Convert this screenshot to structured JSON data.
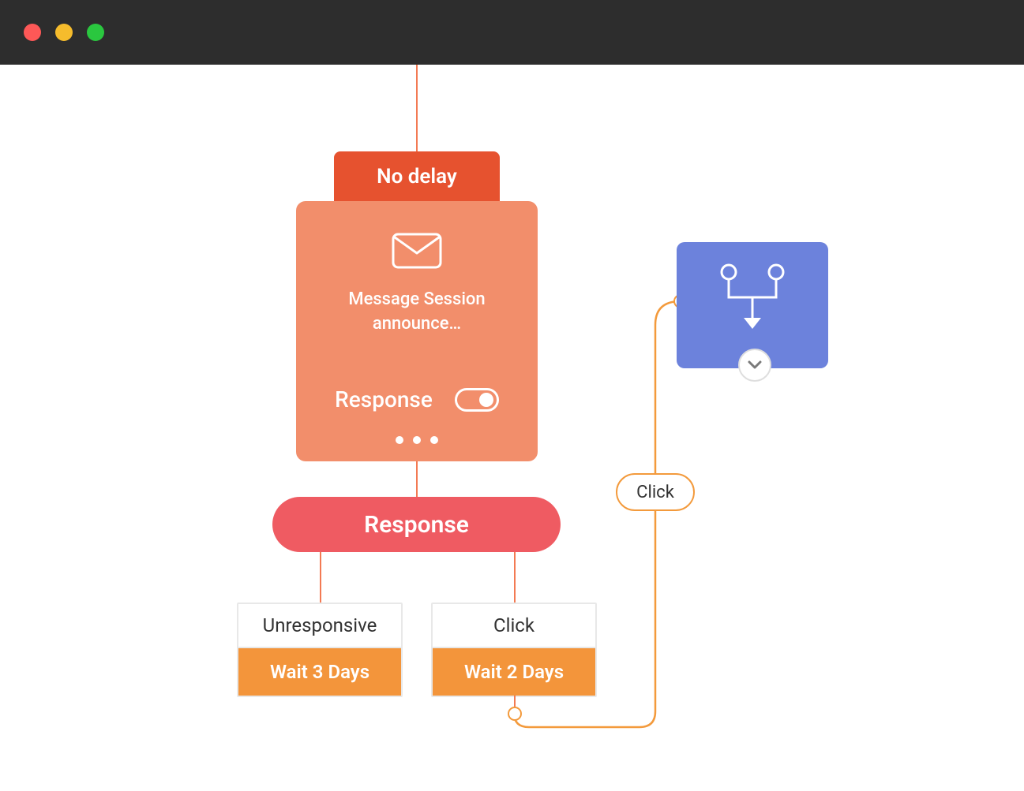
{
  "delay": {
    "label": "No delay"
  },
  "message_card": {
    "line1": "Message Session",
    "line2": "announce…",
    "response_label": "Response",
    "response_toggle_on": true
  },
  "response_split": {
    "label": "Response"
  },
  "branches": {
    "left": {
      "condition": "Unresponsive",
      "wait": "Wait 3 Days"
    },
    "right": {
      "condition": "Click",
      "wait": "Wait 2 Days"
    }
  },
  "click_badge": {
    "label": "Click"
  },
  "colors": {
    "orange_line": "#f37a53",
    "orange_fill": "#f39a3c",
    "card": "#f28e6b",
    "delay": "#e6522f",
    "response": "#ef5b62",
    "merge": "#6c82dc"
  }
}
